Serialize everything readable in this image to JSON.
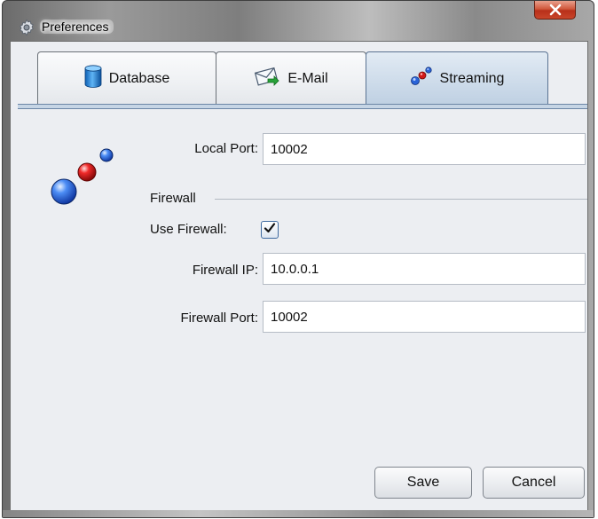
{
  "window": {
    "title": "Preferences",
    "title_icon": "gear-icon",
    "close_label": "X"
  },
  "tabs": [
    {
      "label": "Database",
      "icon": "database-icon",
      "selected": false
    },
    {
      "label": "E-Mail",
      "icon": "email-icon",
      "selected": false
    },
    {
      "label": "Streaming",
      "icon": "streaming-icon",
      "selected": true
    }
  ],
  "streaming": {
    "icon": "streaming-spheres-icon",
    "local_port_label": "Local Port:",
    "local_port_value": "10002",
    "firewall_section_title": "Firewall",
    "use_firewall_label": "Use Firewall:",
    "use_firewall_checked": true,
    "firewall_ip_label": "Firewall IP:",
    "firewall_ip_value": "10.0.0.1",
    "firewall_port_label": "Firewall Port:",
    "firewall_port_value": "10002"
  },
  "buttons": {
    "save_label": "Save",
    "cancel_label": "Cancel"
  },
  "colors": {
    "client_background": "#eceef2",
    "selected_tab": "#c9d8e8",
    "close_button": "#c9452a",
    "sphere_blue": "#2a64d8",
    "sphere_red": "#d11a1a"
  }
}
